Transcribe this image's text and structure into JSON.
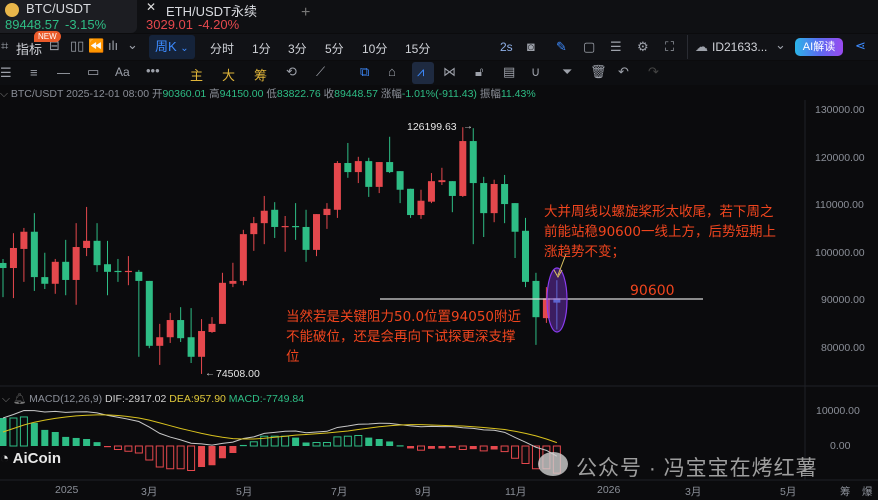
{
  "tabs": [
    {
      "symbol": "BTC/USDT",
      "price": "89448.57",
      "change": "-3.15%",
      "price_color": "#2ebd85"
    },
    {
      "symbol": "ETH/USDT永续",
      "price": "3029.01",
      "change": "-4.20%",
      "price_color": "#e5484d"
    }
  ],
  "toolbar": {
    "indicator": "指标",
    "new_badge": "NEW",
    "period": "周K",
    "intervals": [
      "分时",
      "1分",
      "3分",
      "5分",
      "10分",
      "15分"
    ],
    "refresh": "2s",
    "account": "ID21633...",
    "ai_button": "AI解读"
  },
  "drawbar": {
    "main": "主",
    "big": "大",
    "chips": "筹",
    "text_tool": "Aa"
  },
  "info": {
    "symbol": "BTC/USDT",
    "datetime": "2025-12-01 08:00",
    "open_label": "开",
    "open": "90360.01",
    "high_label": "高",
    "high": "94150.00",
    "low_label": "低",
    "low": "83822.76",
    "close_label": "收",
    "close": "89448.57",
    "change_label": "涨幅",
    "change": "-1.01%(-911.43)",
    "amp_label": "振幅",
    "amplitude": "11.43%"
  },
  "price_axis": [
    "130000.00",
    "120000.00",
    "110000.00",
    "100000.00",
    "90000.00",
    "80000.00"
  ],
  "macd_axis": [
    "10000.00",
    "0.00"
  ],
  "time_axis": [
    "2025",
    "3月",
    "5月",
    "7月",
    "9月",
    "11月",
    "2026",
    "3月",
    "5月"
  ],
  "bottom_right": [
    "筹",
    "爆"
  ],
  "macd_info": {
    "name": "MACD(12,26,9)",
    "dif": "DIF:-2917.02",
    "dea": "DEA:957.90",
    "macd": "MACD:-7749.84"
  },
  "markers": {
    "high": "126199.63",
    "low": "74508.00"
  },
  "annotations": {
    "level": "90600",
    "note_upper": "大并周线以螺旋桨形太收尾，若下周之前能站稳90600一线上方，后势短期上涨趋势不变；",
    "note_lower": "当然若是关键阻力50.0位置94050附近不能破位，还是会再向下试探更深支撑位"
  },
  "watermarks": {
    "logo": "AiCoin",
    "wechat": "公众号 · 冯宝宝在烤红薯"
  },
  "colors": {
    "up": "#e5484d",
    "down": "#2ebd85",
    "accent": "#3d8bff",
    "note": "#f0451e"
  },
  "chart_data": {
    "type": "candlestick",
    "interval": "1W",
    "ylim": [
      70000,
      134000
    ],
    "candles": [
      [
        97760,
        98600,
        90600,
        96700
      ],
      [
        96700,
        104000,
        90400,
        100900
      ],
      [
        100700,
        105100,
        93800,
        104300
      ],
      [
        104300,
        108200,
        91900,
        94800
      ],
      [
        94800,
        99900,
        92300,
        93400
      ],
      [
        93400,
        98600,
        91300,
        98000
      ],
      [
        98000,
        102600,
        91000,
        94200
      ],
      [
        94200,
        106100,
        89000,
        101100
      ],
      [
        100900,
        109500,
        99200,
        102400
      ],
      [
        102400,
        106100,
        95900,
        97300
      ],
      [
        97500,
        102400,
        91000,
        95900
      ],
      [
        96100,
        98600,
        93800,
        95900
      ],
      [
        95900,
        99200,
        93100,
        96100
      ],
      [
        95900,
        96300,
        78100,
        94000
      ],
      [
        94000,
        94000,
        79900,
        80400
      ],
      [
        80400,
        85000,
        76400,
        82200
      ],
      [
        82200,
        87300,
        81000,
        85800
      ],
      [
        85800,
        88500,
        81200,
        82000
      ],
      [
        82200,
        88300,
        76800,
        78100
      ],
      [
        78100,
        86000,
        74508,
        83500
      ],
      [
        83300,
        86400,
        83100,
        85000
      ],
      [
        85000,
        95700,
        85000,
        93600
      ],
      [
        93400,
        97800,
        92700,
        94000
      ],
      [
        94000,
        104700,
        93100,
        103800
      ],
      [
        103800,
        107400,
        100300,
        106100
      ],
      [
        106100,
        111800,
        101700,
        108700
      ],
      [
        108900,
        110500,
        103000,
        105300
      ],
      [
        105300,
        107600,
        100100,
        105500
      ],
      [
        105500,
        110300,
        102600,
        105300
      ],
      [
        105300,
        108900,
        98000,
        100500
      ],
      [
        100500,
        108000,
        99200,
        108000
      ],
      [
        107800,
        110300,
        104900,
        109100
      ],
      [
        108900,
        119100,
        107200,
        118700
      ],
      [
        118700,
        122900,
        115600,
        116800
      ],
      [
        116800,
        120000,
        114500,
        119100
      ],
      [
        119100,
        119800,
        111600,
        113700
      ],
      [
        113700,
        118900,
        112400,
        118900
      ],
      [
        118900,
        124200,
        116600,
        116800
      ],
      [
        117000,
        117000,
        110300,
        113100
      ],
      [
        113300,
        113300,
        107200,
        107800
      ],
      [
        107800,
        113100,
        107000,
        110800
      ],
      [
        110600,
        116600,
        110300,
        114900
      ],
      [
        114700,
        117700,
        114100,
        115100
      ],
      [
        114900,
        114900,
        108400,
        111800
      ],
      [
        111800,
        126199.63,
        111600,
        123300
      ],
      [
        123300,
        126000,
        101700,
        114500
      ],
      [
        114500,
        115800,
        103200,
        108200
      ],
      [
        108200,
        115200,
        106300,
        114300
      ],
      [
        114300,
        116200,
        106100,
        110100
      ],
      [
        110300,
        110300,
        98800,
        104300
      ],
      [
        104500,
        107200,
        92700,
        93800
      ],
      [
        94000,
        95700,
        80600,
        86400
      ],
      [
        86200,
        92700,
        85200,
        90360
      ],
      [
        90360.01,
        94150,
        83822.76,
        89448.57
      ]
    ],
    "macd_hist": [
      8000,
      8000,
      8300,
      6600,
      4600,
      4000,
      2600,
      2300,
      2000,
      1100,
      -300,
      -1000,
      -1500,
      -2000,
      -4000,
      -6000,
      -6500,
      -6500,
      -7000,
      -6000,
      -5500,
      -3500,
      -2000,
      300,
      1200,
      2800,
      2800,
      2800,
      2400,
      1000,
      1000,
      1000,
      2600,
      2800,
      3000,
      2400,
      2000,
      1300,
      200,
      -700,
      -1200,
      -800,
      -700,
      -500,
      -1000,
      -900,
      -1400,
      -1000,
      -1600,
      -3500,
      -5000,
      -6500,
      -6500,
      -7749.84
    ],
    "dea": [
      4000,
      5000,
      6000,
      6800,
      7400,
      7900,
      8300,
      8600,
      8800,
      8900,
      8900,
      8700,
      8400,
      8000,
      7400,
      6600,
      5800,
      5000,
      4300,
      3600,
      3000,
      2500,
      2100,
      2000,
      2000,
      2200,
      2500,
      2800,
      3100,
      3300,
      3500,
      3700,
      4000,
      4300,
      4700,
      5100,
      5500,
      5800,
      6000,
      6100,
      6100,
      6000,
      5900,
      5800,
      5700,
      5500,
      5300,
      5000,
      4700,
      4200,
      3600,
      2900,
      2000,
      957.9
    ],
    "horizontal_level": 90600
  }
}
